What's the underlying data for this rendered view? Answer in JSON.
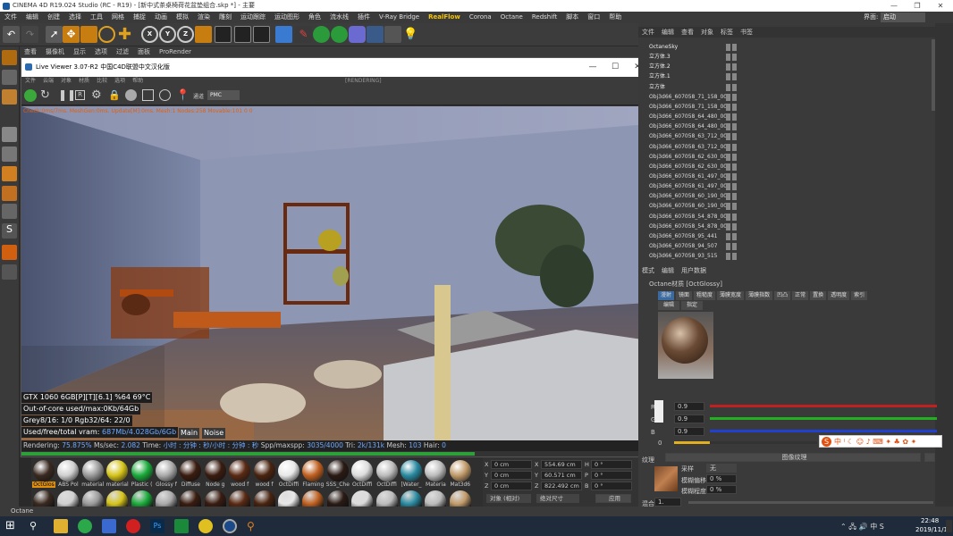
{
  "window": {
    "title": "CINEMA 4D R19.024 Studio (RC - R19) - [新中式茶桌椅荷花盆垫组合.skp *] - 主要"
  },
  "menubar": {
    "items": [
      "文件",
      "编辑",
      "创建",
      "选择",
      "工具",
      "网格",
      "捕捉",
      "动画",
      "模拟",
      "渲染",
      "雕刻",
      "运动跟踪",
      "运动图形",
      "角色",
      "流水线",
      "插件",
      "V-Ray Bridge",
      "RealFlow",
      "Corona",
      "Octane",
      "Redshift",
      "脚本",
      "窗口",
      "帮助"
    ],
    "layout_label": "界面:",
    "layout_value": "启动"
  },
  "viewport_menu": [
    "查看",
    "摄像机",
    "显示",
    "选项",
    "过滤",
    "面板",
    "ProRender"
  ],
  "live_viewer": {
    "title": "Live Viewer 3.07-R2 中国C4D联盟中文汉化版",
    "menu": [
      "文件",
      "云端",
      "对象",
      "材质",
      "比较",
      "选项",
      "帮助"
    ],
    "status": "[RENDERING]",
    "channel_label": "通道",
    "channel_value": "PMC",
    "debug_line": "Check:0ms/7ms. MeshGen:0ms. Update[M]:0ms. Mesh:1 Nodes:258 Movable:101  0 0",
    "overlay": {
      "gpu": "GTX 1060 6GB[P][T][6.1]    %64     69°C",
      "out_of_core": "Out-of-core used/max:0Kb/64Gb",
      "grey": "Grey8/16: 1/0          Rgb32/64: 22/0",
      "vram_label": "Used/free/total vram: ",
      "vram_value": "687Mb/4.028Gb/6Gb",
      "tab_main": "Main",
      "tab_noise": "Noise"
    },
    "stats": {
      "rendering_label": "Rendering: ",
      "rendering_value": "75.875%",
      "ms_label": "  Ms/sec: ",
      "ms_value": "2.082",
      "time_label": "   Time: ",
      "time_value": "小时 : 分钟 : 秒/小时 : 分钟 : 秒",
      "spp_label": "   Spp/maxspp: ",
      "spp_value": "3035/4000",
      "tri_label": "  Tri: ",
      "tri_value": "2k/131k",
      "mesh_label": "   Mesh: ",
      "mesh_value": "103",
      "hair_label": "  Hair: ",
      "hair_value": "0"
    },
    "progress": 0.75875
  },
  "materials": [
    {
      "label": "OctGlos",
      "color": "#3a2a20"
    },
    {
      "label": "ABS Pol",
      "color": "#d0d0d0"
    },
    {
      "label": "material",
      "color": "#9a9a9a"
    },
    {
      "label": "material",
      "color": "#d6c41a"
    },
    {
      "label": "Plastic (",
      "color": "#1aaa3a"
    },
    {
      "label": "Glossy f",
      "color": "#aaaaaa"
    },
    {
      "label": "Diffuse",
      "color": "#3a1c10"
    },
    {
      "label": "Node g",
      "color": "#3a1c10"
    },
    {
      "label": "wood f",
      "color": "#5a2a14"
    },
    {
      "label": "wood f",
      "color": "#4a2410"
    },
    {
      "label": "OctDiffi",
      "color": "#e8e8e8"
    },
    {
      "label": "Flaming",
      "color": "#c06020"
    },
    {
      "label": "SSS_Che",
      "color": "#2a1a14"
    },
    {
      "label": "OctDiffi",
      "color": "#dcdcdc"
    },
    {
      "label": "OctDiffi",
      "color": "#bcbcbc"
    },
    {
      "label": "[Water_",
      "color": "#2a8aa0"
    },
    {
      "label": "Materia",
      "color": "#bcbcbc"
    },
    {
      "label": "Mat3d6",
      "color": "#c09a6a"
    }
  ],
  "coords": {
    "x_pos": "0 cm",
    "y_pos": "0 cm",
    "z_pos": "0 cm",
    "x_size": "554.69 cm",
    "y_size": "60.571 cm",
    "z_size": "822.492 cm",
    "h": "0 °",
    "p": "0 °",
    "b": "0 °",
    "mode1": "对象 (相对)",
    "mode2": "绝对尺寸",
    "apply": "应用"
  },
  "object_manager": {
    "menu": [
      "文件",
      "编辑",
      "查看",
      "对象",
      "标签",
      "书签"
    ],
    "items": [
      "OctaneSky",
      "立方体.3",
      "立方体.2",
      "立方体.1",
      "立方体",
      "Obj3d66_607058_71_158_002",
      "Obj3d66_607058_71_158_001",
      "Obj3d66_607058_64_480_002",
      "Obj3d66_607058_64_480_001",
      "Obj3d66_607058_63_712_002",
      "Obj3d66_607058_63_712_001",
      "Obj3d66_607058_62_630_002",
      "Obj3d66_607058_62_630_001",
      "Obj3d66_607058_61_497_002",
      "Obj3d66_607058_61_497_001",
      "Obj3d66_607058_60_190_002",
      "Obj3d66_607058_60_190_001",
      "Obj3d66_607058_54_878_002",
      "Obj3d66_607058_54_878_001",
      "Obj3d66_607058_95_441",
      "Obj3d66_607058_94_507",
      "Obj3d66_607058_93_515"
    ]
  },
  "attributes": {
    "menu": [
      "模式",
      "编辑",
      "用户数据"
    ],
    "title": "Octane材质 [OctGlossy]",
    "tabs1": [
      "漫射",
      "镜面",
      "粗糙度",
      "薄膜宽度",
      "薄膜指数",
      "凹凸",
      "正常",
      "置换",
      "透明度",
      "索引"
    ],
    "tabs2": [
      "编辑",
      "指定"
    ],
    "r_label": "R",
    "r_value": "0.9",
    "g_label": "G",
    "g_value": "0.9",
    "b_label": "B",
    "b_value": "0.9",
    "zero": "0",
    "texture_label": "纹理",
    "image_texture": "图像纹理",
    "sample_label": "采样",
    "sample_value": "无",
    "blur_offset_label": "模糊偏移",
    "blur_offset_value": "0 %",
    "blur_level_label": "模糊程度",
    "blur_level_value": "0 %",
    "mix_label": "混合",
    "mix_value": "1."
  },
  "statusbar": {
    "text": "Octane"
  },
  "taskbar": {
    "time": "22:48",
    "date": "2019/11/1"
  }
}
